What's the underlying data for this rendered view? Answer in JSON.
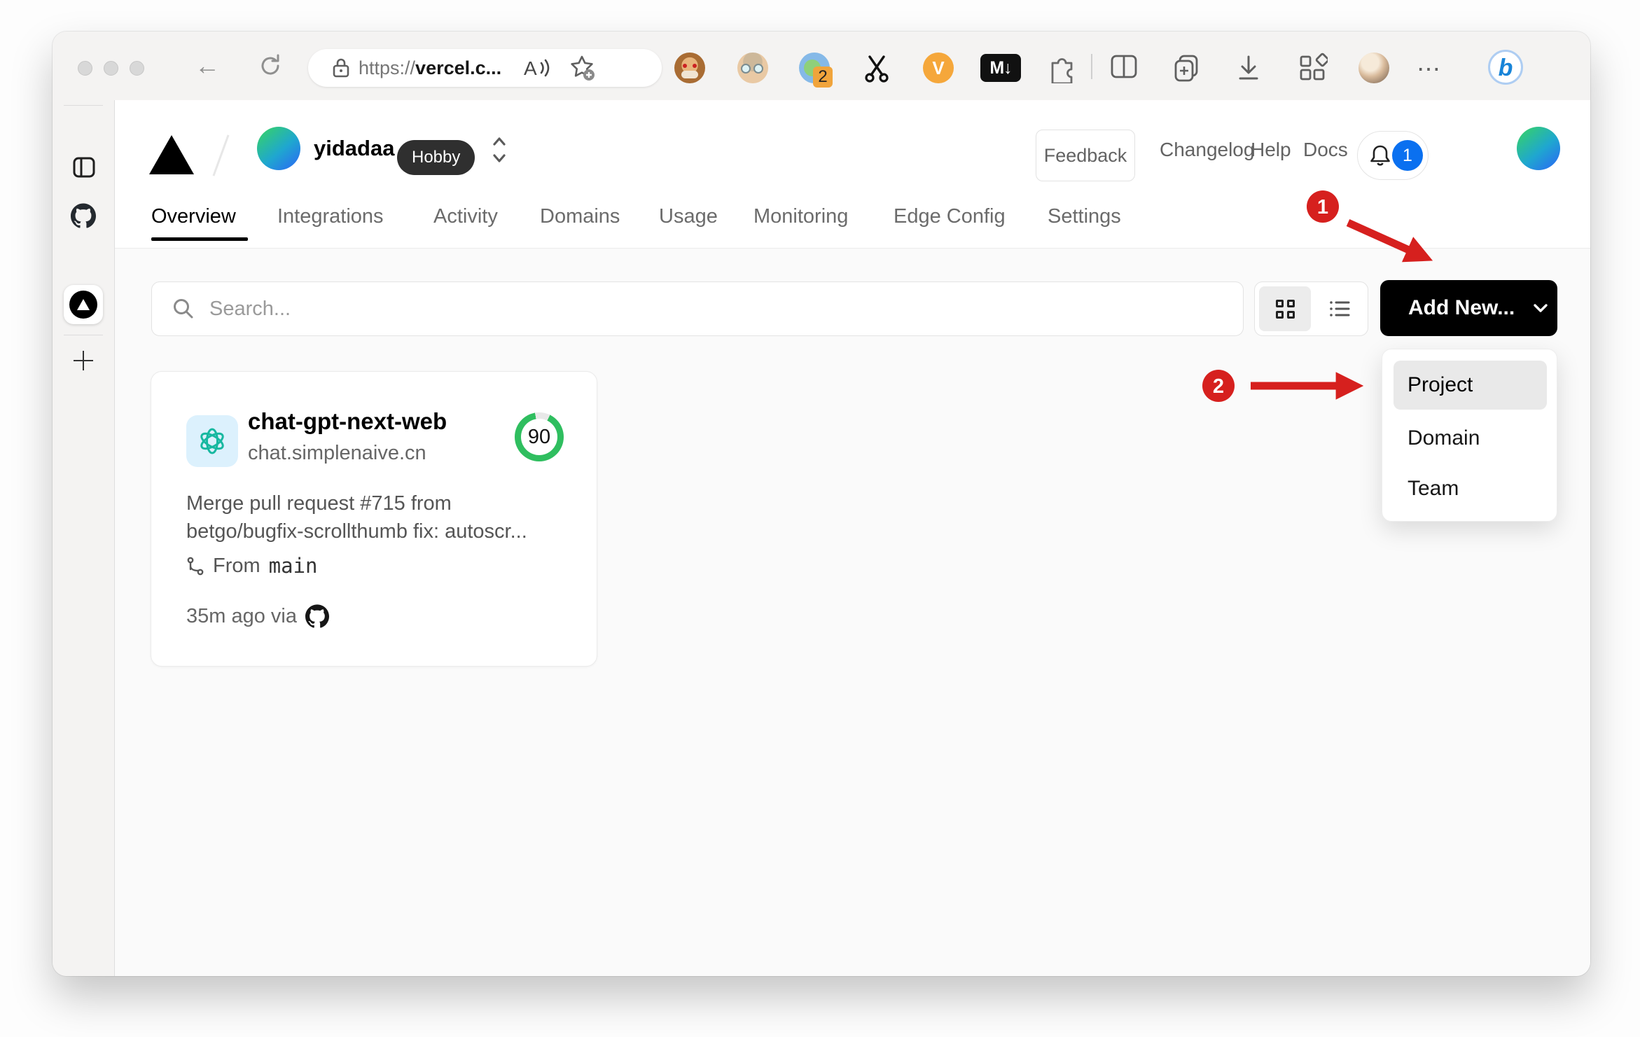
{
  "browser": {
    "url": {
      "scheme": "https://",
      "host": "vercel.c..."
    },
    "ext_badge": "2",
    "v_label": "V",
    "md_label": "M↓",
    "bing_label": "b"
  },
  "vercel": {
    "team": {
      "name": "yidadaa",
      "plan": "Hobby"
    },
    "links": {
      "feedback": "Feedback",
      "changelog": "Changelog",
      "help": "Help",
      "docs": "Docs"
    },
    "notif_count": "1",
    "tabs": [
      {
        "label": "Overview",
        "active": true
      },
      {
        "label": "Integrations",
        "active": false
      },
      {
        "label": "Activity",
        "active": false
      },
      {
        "label": "Domains",
        "active": false
      },
      {
        "label": "Usage",
        "active": false
      },
      {
        "label": "Monitoring",
        "active": false
      },
      {
        "label": "Edge Config",
        "active": false
      },
      {
        "label": "Settings",
        "active": false
      }
    ],
    "search_placeholder": "Search...",
    "add_new": "Add New...",
    "dropdown": [
      {
        "label": "Project",
        "highlighted": true
      },
      {
        "label": "Domain",
        "highlighted": false
      },
      {
        "label": "Team",
        "highlighted": false
      }
    ],
    "card": {
      "name": "chat-gpt-next-web",
      "domain": "chat.simplenaive.cn",
      "score": "90",
      "commit": [
        "Merge pull request #715 from",
        "betgo/bugfix-scrollthumb fix: autoscr..."
      ],
      "branch_prefix": "From",
      "branch_name": "main",
      "deployed": "35m ago via"
    }
  },
  "annotations": {
    "step1": "1",
    "step2": "2"
  },
  "colors": {
    "annotation_red": "#d6201e",
    "score_green": "#2fbe5f",
    "notification_blue": "#0a70f0",
    "add_new_black": "#000000",
    "avatar_gradient": [
      "#36d169",
      "#2a6cf2"
    ]
  }
}
